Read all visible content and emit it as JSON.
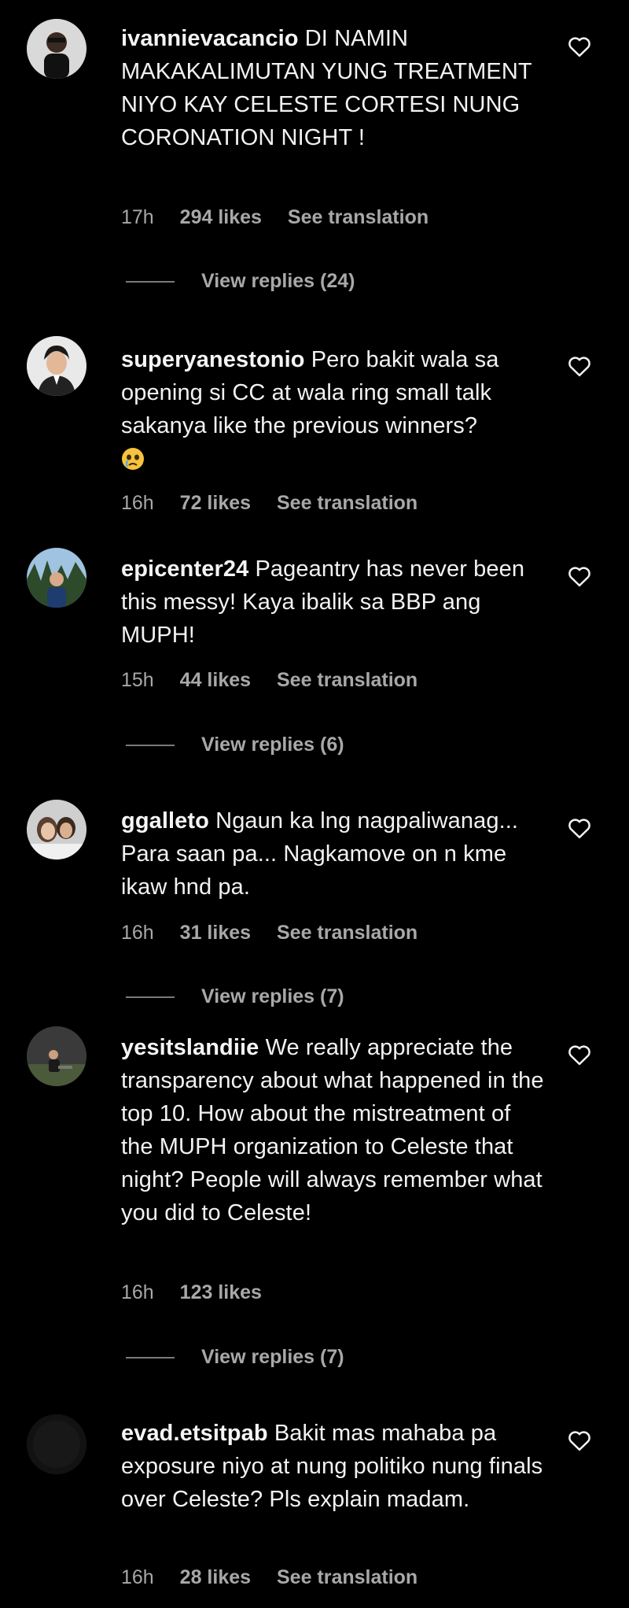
{
  "comments": [
    {
      "username": "ivannievacancio",
      "text": "DI NAMIN MAKAKALIMUTAN YUNG TREATMENT NIYO KAY CELESTE CORTESI NUNG CORONATION NIGHT !",
      "time": "17h",
      "likes": "294 likes",
      "translate": "See translation",
      "replies": "View replies (24)"
    },
    {
      "username": "superyanestonio",
      "text": "Pero bakit wala sa opening si CC at wala ring small talk sakanya like the previous winners?",
      "emoji": "crying-face-emoji",
      "time": "16h",
      "likes": "72 likes",
      "translate": "See translation",
      "replies": null
    },
    {
      "username": "epicenter24",
      "text": "Pageantry has never been this messy! Kaya ibalik sa BBP ang MUPH!",
      "time": "15h",
      "likes": "44 likes",
      "translate": "See translation",
      "replies": "View replies (6)"
    },
    {
      "username": "ggalleto",
      "text": "Ngaun ka lng nagpaliwanag... Para saan pa... Nagkamove on n kme ikaw hnd pa.",
      "time": "16h",
      "likes": "31 likes",
      "translate": "See translation",
      "replies": "View replies (7)"
    },
    {
      "username": "yesitslandiie",
      "text": "We really appreciate the transparency about what happened in the top 10. How about the mistreatment of the MUPH organization to Celeste that night? People will always remember what you did to Celeste!",
      "time": "16h",
      "likes": "123 likes",
      "translate": null,
      "replies": "View replies (7)"
    },
    {
      "username": "evad.etsitpab",
      "text": "Bakit mas mahaba pa exposure niyo at nung politiko nung finals over Celeste? Pls explain madam.",
      "time": "16h",
      "likes": "28 likes",
      "translate": "See translation",
      "replies": null
    }
  ],
  "icons": {
    "like": "heart-outline-icon"
  },
  "colors": {
    "background": "#000000",
    "text": "#f5f5f5",
    "meta": "#a8a8a8"
  }
}
